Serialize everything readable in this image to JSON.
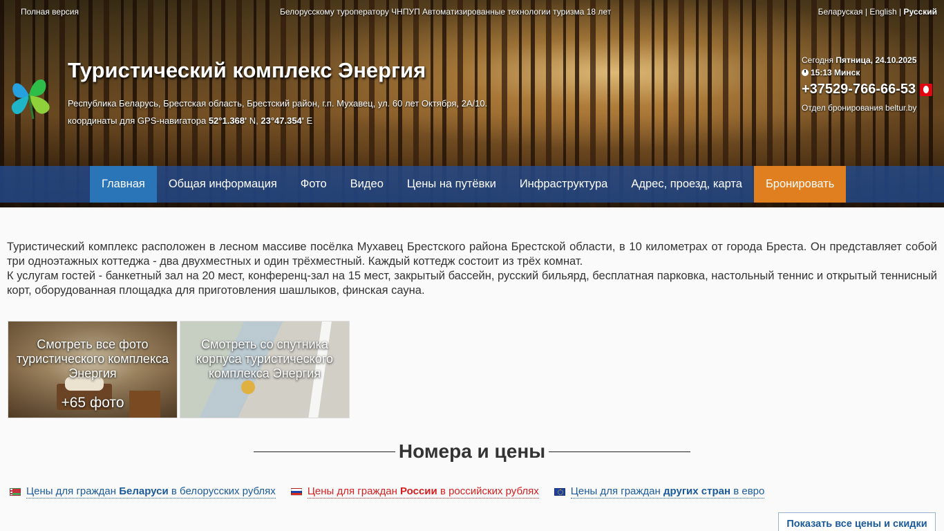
{
  "topbar": {
    "full_version": "Полная версия",
    "tagline": "Белорусскому туроператору ЧНПУП Автоматизированные технологии туризма 18 лет",
    "langs": [
      "Беларуская",
      "English",
      "Русский"
    ],
    "lang_separator": "|"
  },
  "header": {
    "title": "Туристический комплекс Энергия",
    "address": "Республика Беларусь, Брестская область, Брестский район, г.п. Мухавец, ул. 60 лет Октября, 2А/10.",
    "coords_label": "координаты для GPS-навигатора",
    "coords_lat": "52°1.368'",
    "coords_lat_suffix": "N,",
    "coords_lon": "23°47.354'",
    "coords_lon_suffix": "E",
    "today_label": "Сегодня",
    "today_date": "Пятница, 24.10.2025",
    "time": "15:13 Минск",
    "phone": "+37529-766-66-53",
    "booking_dept": "Отдел бронирования beltur.by"
  },
  "nav": {
    "items": [
      "Главная",
      "Общая информация",
      "Фото",
      "Видео",
      "Цены на путёвки",
      "Инфраструктура",
      "Адрес, проезд, карта",
      "Бронировать"
    ],
    "active_index": 0,
    "accent": "#e07f1f"
  },
  "intro": {
    "p1": "Туристический комплекс расположен в лесном массиве посёлка Мухавец Брестского района Брестской области, в 10 километрах от города Бреста. Он представляет собой три одноэтажных коттеджа - два двухместных и один трёхместный. Каждый коттедж состоит из трёх комнат.",
    "p2": "К услугам гостей - банкетный зал на 20 мест, конференц-зал на 15 мест, закрытый бассейн, русский бильярд, бесплатная парковка, настольный теннис и открытый теннисный корт, оборудованная площадка для приготовления шашлыков, финская сауна."
  },
  "tiles": {
    "photos_caption": "Смотреть все фото туристического комплекса Энергия",
    "photos_count": "+65 фото",
    "map_caption": "Смотреть со спутника корпуса туристического комплекса Энергия"
  },
  "prices": {
    "section_title": "Номера и цены",
    "by": {
      "pre": "Цены для граждан",
      "strong": "Беларуси",
      "post": "в белорусских рублях"
    },
    "ru": {
      "pre": "Цены для граждан",
      "strong": "России",
      "post": "в российских рублях"
    },
    "eu": {
      "pre": "Цены для граждан",
      "strong": "других стран",
      "post": "в евро"
    },
    "show_all": "Показать все цены и скидки"
  }
}
